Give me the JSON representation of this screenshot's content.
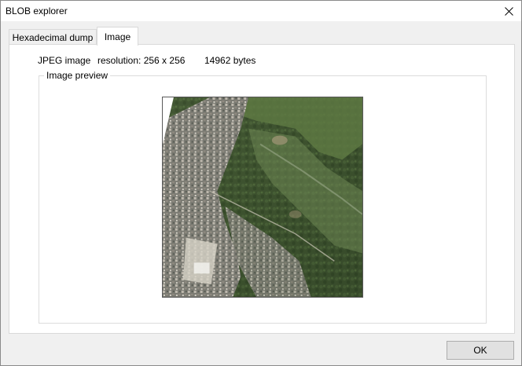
{
  "window": {
    "title": "BLOB explorer"
  },
  "tabs": [
    {
      "label": "Hexadecimal dump",
      "active": false
    },
    {
      "label": "Image",
      "active": true
    }
  ],
  "image_info": {
    "type": "JPEG image",
    "resolution": "resolution: 256 x 256",
    "size": "14962 bytes"
  },
  "preview": {
    "group_label": "Image preview",
    "content": "aerial-photo-green-hills-with-town"
  },
  "footer": {
    "ok_label": "OK"
  },
  "colors": {
    "window_bg": "#f0f0f0",
    "panel_bg": "#ffffff",
    "button_bg": "#e1e1e1",
    "border": "#adadad"
  }
}
